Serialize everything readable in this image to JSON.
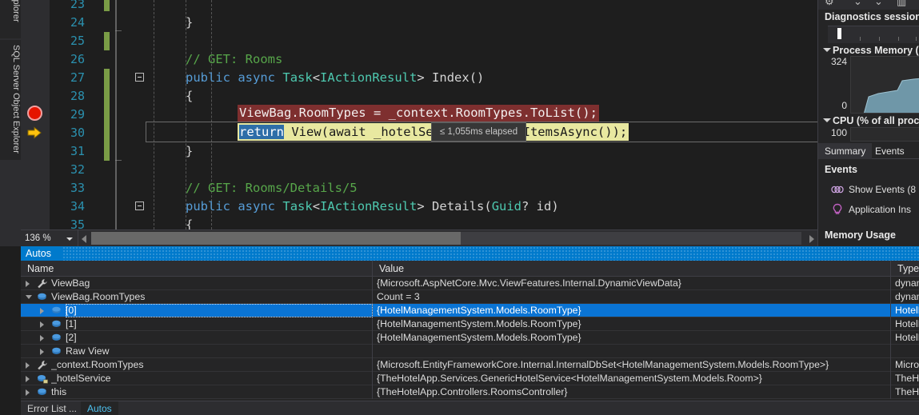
{
  "left_rail": {
    "tabs": [
      {
        "label": "Solution Explorer",
        "visible_text": "xplorer"
      },
      {
        "label": "SQL Server Object Explorer",
        "visible_text": "SQL Server Object Explorer"
      }
    ]
  },
  "editor": {
    "zoom_level": "136 %",
    "breakpoint_line": 29,
    "current_line": 30,
    "perf_tip": "≤ 1,055ms elapsed",
    "lines": [
      {
        "num": "23",
        "text": ""
      },
      {
        "num": "24",
        "text": "}"
      },
      {
        "num": "25",
        "text": ""
      },
      {
        "num": "26",
        "text": "// GET: Rooms"
      },
      {
        "num": "27",
        "text": "public async Task<IActionResult> Index()"
      },
      {
        "num": "28",
        "text": "{"
      },
      {
        "num": "29",
        "text": "ViewBag.RoomTypes = _context.RoomTypes.ToList();"
      },
      {
        "num": "30",
        "text": "return View(await _hotelService.GetAllItemsAsync());"
      },
      {
        "num": "31",
        "text": "}"
      },
      {
        "num": "32",
        "text": ""
      },
      {
        "num": "33",
        "text": "// GET: Rooms/Details/5"
      },
      {
        "num": "34",
        "text": "public async Task<IActionResult> Details(Guid? id)"
      },
      {
        "num": "35",
        "text": "{"
      }
    ],
    "code_tokens": {
      "l24_brace": "}",
      "l26_comment": "// GET: Rooms",
      "l27_public": "public",
      "l27_async": "async",
      "l27_task": "Task",
      "l27_lt": "<",
      "l27_iactionresult": "IActionResult",
      "l27_gt": "> ",
      "l27_index": "Index()",
      "l28_brace": "{",
      "l29_full": "ViewBag.RoomTypes = _context.RoomTypes.ToList();",
      "l30_return": "return",
      "l30_rest": " View(await _hotelService.GetAllItemsAsync());",
      "l31_brace": "}",
      "l33_comment": "// GET: Rooms/Details/5",
      "l34_public": "public",
      "l34_async": "async",
      "l34_task": "Task",
      "l34_lt": "<",
      "l34_iactionresult": "IActionResult",
      "l34_gt": "> ",
      "l34_details": "Details(",
      "l34_guid": "Guid",
      "l34_idparam": "? id)",
      "l35_brace": "{"
    }
  },
  "diagnostics": {
    "title": "Diagnostics session",
    "process_memory": {
      "header": "Process Memory (",
      "max": "324",
      "min": "0"
    },
    "cpu": {
      "header": "CPU (% of all proc",
      "max": "100"
    },
    "tabs": [
      {
        "label": "Summary",
        "active": true
      },
      {
        "label": "Events",
        "active": false
      }
    ],
    "events_header": "Events",
    "event_rows": [
      {
        "label": "Show Events (8",
        "icon": "events-icon"
      },
      {
        "label": "Application Ins",
        "icon": "lightbulb-icon"
      }
    ],
    "memory_usage_header": "Memory Usage"
  },
  "autos": {
    "panel_title": "Autos",
    "columns": [
      "Name",
      "Value",
      "Type"
    ],
    "rows": [
      {
        "indent": 0,
        "expander": "collapsed",
        "icon": "property-icon",
        "name": "ViewBag",
        "value": "{Microsoft.AspNetCore.Mvc.ViewFeatures.Internal.DynamicViewData}",
        "type": "dynami",
        "selected": false
      },
      {
        "indent": 0,
        "expander": "expanded",
        "icon": "field-icon",
        "name": "ViewBag.RoomTypes",
        "value": "Count = 3",
        "type": "dynami",
        "selected": false
      },
      {
        "indent": 1,
        "expander": "collapsed",
        "icon": "field-icon",
        "name": "[0]",
        "value": "{HotelManagementSystem.Models.RoomType}",
        "type": "HotelM",
        "selected": true
      },
      {
        "indent": 1,
        "expander": "collapsed",
        "icon": "field-icon",
        "name": "[1]",
        "value": "{HotelManagementSystem.Models.RoomType}",
        "type": "HotelM",
        "selected": false
      },
      {
        "indent": 1,
        "expander": "collapsed",
        "icon": "field-icon",
        "name": "[2]",
        "value": "{HotelManagementSystem.Models.RoomType}",
        "type": "HotelM",
        "selected": false
      },
      {
        "indent": 1,
        "expander": "collapsed",
        "icon": "field-icon",
        "name": "Raw View",
        "value": "",
        "type": "",
        "selected": false
      },
      {
        "indent": 0,
        "expander": "collapsed",
        "icon": "property-icon",
        "name": "_context.RoomTypes",
        "value": "{Microsoft.EntityFrameworkCore.Internal.InternalDbSet<HotelManagementSystem.Models.RoomType>}",
        "type": "Microso",
        "selected": false
      },
      {
        "indent": 0,
        "expander": "collapsed",
        "icon": "field-private-icon",
        "name": "_hotelService",
        "value": "{TheHotelApp.Services.GenericHotelService<HotelManagementSystem.Models.Room>}",
        "type": "TheHot",
        "selected": false
      },
      {
        "indent": 0,
        "expander": "collapsed",
        "icon": "field-icon",
        "name": "this",
        "value": "{TheHotelApp.Controllers.RoomsController}",
        "type": "TheHot",
        "selected": false
      }
    ],
    "bottom_tabs": [
      {
        "label": "Error List ...",
        "active": false
      },
      {
        "label": "Autos",
        "active": true
      }
    ]
  },
  "colors": {
    "accent_blue": "#007acc",
    "selection_blue": "#0a74d4",
    "exception_red": "#7e2f2f",
    "current_stmt_yellow": "#e8e8a0",
    "changebar_green": "#7a9c46",
    "breakpoint_red": "#e51400"
  }
}
